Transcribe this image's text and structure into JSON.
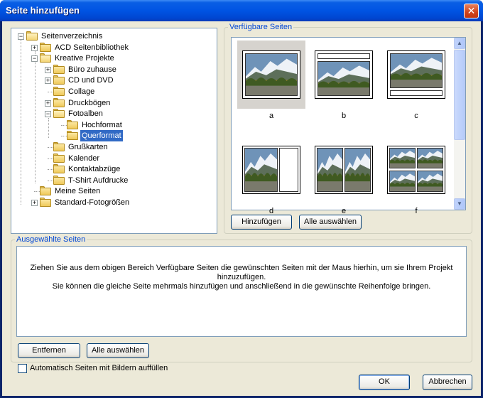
{
  "window": {
    "title": "Seite hinzufügen",
    "close_glyph": "✕"
  },
  "tree": {
    "items": [
      {
        "label": "Seitenverzeichnis",
        "expander": "−"
      },
      {
        "label": "ACD Seitenbibliothek",
        "expander": "+"
      },
      {
        "label": "Kreative Projekte",
        "expander": "−"
      },
      {
        "label": "Büro zuhause",
        "expander": "+"
      },
      {
        "label": "CD und DVD",
        "expander": "+"
      },
      {
        "label": "Collage",
        "expander": ""
      },
      {
        "label": "Druckbögen",
        "expander": "+"
      },
      {
        "label": "Fotoalben",
        "expander": "−"
      },
      {
        "label": "Hochformat",
        "expander": ""
      },
      {
        "label": "Querformat",
        "expander": "",
        "selected": true
      },
      {
        "label": "Grußkarten",
        "expander": ""
      },
      {
        "label": "Kalender",
        "expander": ""
      },
      {
        "label": "Kontaktabzüge",
        "expander": ""
      },
      {
        "label": "T-Shirt Aufdrucke",
        "expander": ""
      },
      {
        "label": "Meine Seiten",
        "expander": ""
      },
      {
        "label": "Standard-Fotogrößen",
        "expander": "+"
      }
    ]
  },
  "available": {
    "title": "Verfügbare Seiten",
    "thumbnails": [
      {
        "label": "a",
        "selected": true
      },
      {
        "label": "b"
      },
      {
        "label": "c"
      },
      {
        "label": "d"
      },
      {
        "label": "e"
      },
      {
        "label": "f"
      }
    ],
    "add_button": "Hinzufügen",
    "select_all_button": "Alle auswählen"
  },
  "selected": {
    "title": "Ausgewählte Seiten",
    "line1": "Ziehen Sie aus dem obigen Bereich Verfügbare Seiten die gewünschten Seiten mit der Maus hierhin, um sie Ihrem Projekt",
    "line2": "hinzuzufügen.",
    "line3": "Sie können die gleiche Seite mehrmals hinzufügen und anschließend in die gewünschte Reihenfolge bringen.",
    "remove_button": "Entfernen",
    "select_all_button": "Alle auswählen"
  },
  "autofill": {
    "label": "Automatisch Seiten mit Bildern auffüllen",
    "checked": false
  },
  "footer": {
    "ok": "OK",
    "cancel": "Abbrechen"
  },
  "colors": {
    "title_bar": "#0054e3",
    "group_title": "#0046d5",
    "selection": "#316ac5",
    "dialog_bg": "#ece9d8"
  },
  "icons": {
    "folder": "folder-icon",
    "close": "close-icon",
    "scroll_up": "scroll-up-icon",
    "scroll_down": "scroll-down-icon"
  }
}
